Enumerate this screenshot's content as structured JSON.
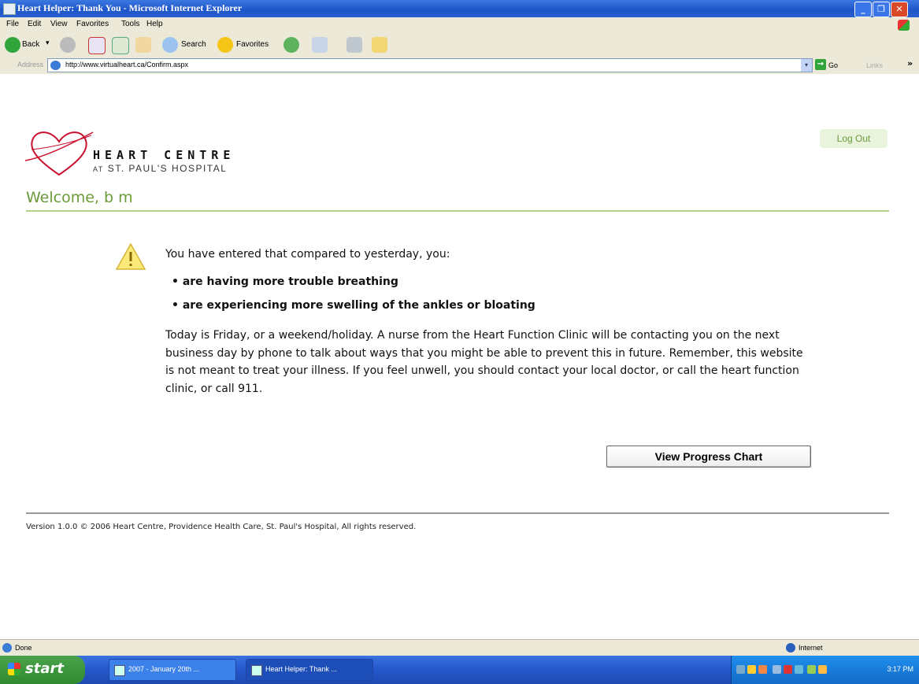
{
  "window": {
    "title": "Heart Helper: Thank You - Microsoft Internet Explorer",
    "buttons": [
      "_",
      "❐",
      "✕"
    ]
  },
  "menu": [
    "File",
    "Edit",
    "View",
    "Favorites",
    "Tools",
    "Help"
  ],
  "toolbar": {
    "back_label": "Back",
    "search_label": "Search",
    "favorites_label": "Favorites"
  },
  "address": {
    "label": "Address",
    "url": "http://www.virtualheart.ca/Confirm.aspx",
    "go_label": "Go",
    "links_label": "Links"
  },
  "header": {
    "heart_centre": "HEART CENTRE",
    "hospital": "ST. PAUL'S HOSPITAL",
    "at": "AT",
    "logout": "Log Out"
  },
  "welcome": "Welcome, b m",
  "message": {
    "intro": "You have entered that compared to yesterday, you:",
    "bullets": [
      "are having more trouble breathing",
      "are experiencing more swelling of the ankles or bloating"
    ],
    "paragraph": "Today is Friday, or a weekend/holiday. A nurse from the Heart Function Clinic will be contacting you on the next business day by phone to talk about ways that you might be able to prevent this in future. Remember, this website is not meant to treat your illness. If you feel unwell, you should contact your local doctor, or call the heart function clinic, or call 911."
  },
  "progress_button": "View Progress Chart",
  "footer": "Version 1.0.0 © 2006 Heart Centre, Providence Health Care, St. Paul's Hospital, All rights reserved.",
  "status": {
    "text": "Done",
    "zone": "Internet"
  },
  "taskbar": {
    "start": "start",
    "tasks": [
      "2007 - January 20th ...",
      "Heart Helper: Thank ..."
    ],
    "clock": "3:17 PM"
  },
  "colors": {
    "brand_green": "#6a9a3a",
    "heart_red": "#c8102e",
    "xp_blue": "#245edb"
  }
}
